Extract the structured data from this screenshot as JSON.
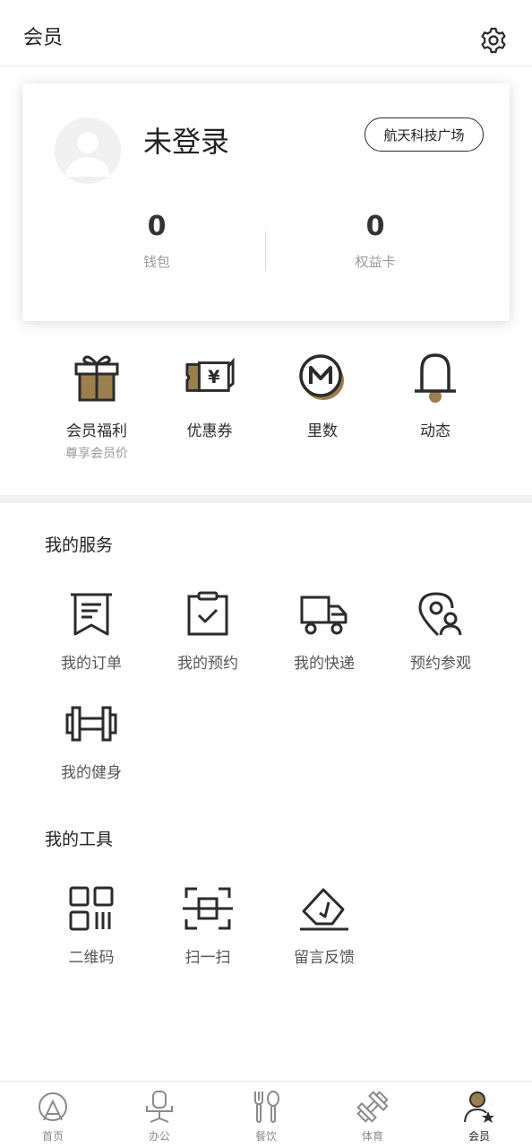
{
  "header": {
    "title": "会员"
  },
  "profile": {
    "status": "未登录",
    "location": "航天科技广场",
    "wallet": {
      "value": "0",
      "label": "钱包"
    },
    "benefit_card": {
      "value": "0",
      "label": "权益卡"
    }
  },
  "quick": [
    {
      "label": "会员福利",
      "sub": "尊享会员价",
      "icon": "gift-icon"
    },
    {
      "label": "优惠券",
      "sub": "",
      "icon": "coupon-icon"
    },
    {
      "label": "里数",
      "sub": "",
      "icon": "mileage-coin-icon"
    },
    {
      "label": "动态",
      "sub": "",
      "icon": "bell-icon"
    }
  ],
  "services": {
    "title": "我的服务",
    "items": [
      {
        "label": "我的订单",
        "icon": "receipt-icon"
      },
      {
        "label": "我的预约",
        "icon": "clipboard-check-icon"
      },
      {
        "label": "我的快递",
        "icon": "delivery-truck-icon"
      },
      {
        "label": "预约参观",
        "icon": "location-person-icon"
      },
      {
        "label": "我的健身",
        "icon": "dumbbell-icon"
      }
    ]
  },
  "tools": {
    "title": "我的工具",
    "items": [
      {
        "label": "二维码",
        "icon": "qr-code-icon"
      },
      {
        "label": "扫一扫",
        "icon": "scan-icon"
      },
      {
        "label": "留言反馈",
        "icon": "feedback-icon"
      }
    ]
  },
  "tabbar": {
    "items": [
      {
        "label": "首页",
        "icon": "home-icon"
      },
      {
        "label": "办公",
        "icon": "office-chair-icon"
      },
      {
        "label": "餐饮",
        "icon": "fork-spoon-icon"
      },
      {
        "label": "体育",
        "icon": "sports-dumbbell-icon"
      },
      {
        "label": "会员",
        "icon": "member-icon"
      }
    ],
    "active": "会员"
  },
  "colors": {
    "accent": "#9b7f4f",
    "text": "#2b2b2b",
    "muted": "#9a9a9a"
  }
}
